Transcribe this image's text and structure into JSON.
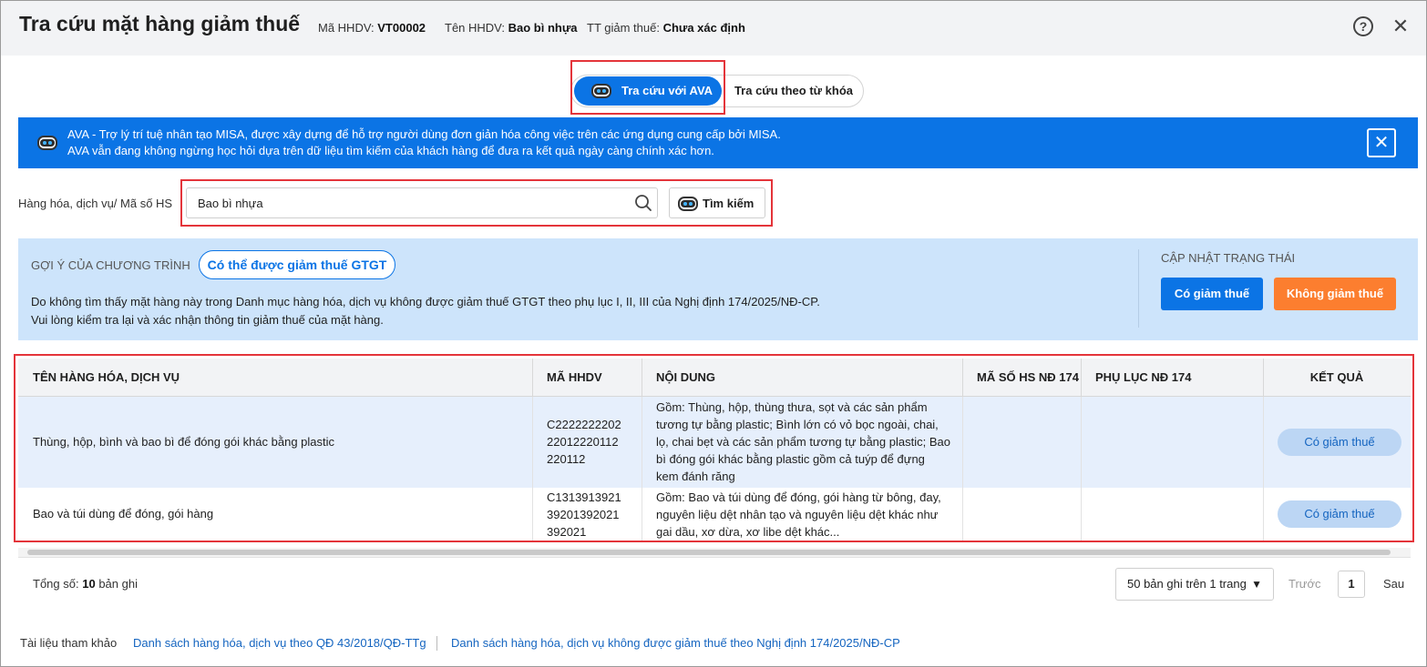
{
  "header": {
    "title": "Tra cứu mặt hàng giảm thuế",
    "meta": [
      {
        "label": "Mã HHDV:",
        "value": "VT00002"
      },
      {
        "label": "Tên HHDV:",
        "value": "Bao bì nhựa"
      },
      {
        "label": "TT giảm thuế:",
        "value": "Chưa xác định"
      }
    ],
    "help_icon": "help-circle-icon",
    "close_icon": "close-icon"
  },
  "mode_tabs": {
    "ava": "Tra cứu với AVA",
    "keyword": "Tra cứu theo từ khóa",
    "active": "ava"
  },
  "banner": {
    "line1": "AVA - Trợ lý trí tuệ nhân tạo MISA, được xây dựng để hỗ trợ người dùng đơn giản hóa công việc trên các ứng dụng cung cấp bởi MISA.",
    "line2": "AVA vẫn đang không ngừng học hỏi dựa trên dữ liệu tìm kiếm của khách hàng để đưa ra kết quả ngày càng chính xác hơn."
  },
  "search": {
    "label": "Hàng hóa, dịch vụ/ Mã số HS",
    "value": "Bao bì nhựa",
    "button": "Tìm kiếm"
  },
  "suggestion": {
    "title": "GỢI Ý CỦA CHƯƠNG TRÌNH",
    "chip": "Có thể được giảm thuế GTGT",
    "line1": "Do không tìm thấy mặt hàng này trong Danh mục hàng hóa, dịch vụ không được giảm thuế GTGT theo phụ lục I, II, III của Nghị định 174/2025/NĐ-CP.",
    "line2": "Vui lòng kiểm tra lại và xác nhận thông tin giảm thuế của mặt hàng.",
    "status_title": "CẬP NHẬT TRẠNG THÁI",
    "btn_yes": "Có giảm thuế",
    "btn_no": "Không giảm thuế"
  },
  "table": {
    "columns": [
      "TÊN HÀNG HÓA, DỊCH VỤ",
      "MÃ HHDV",
      "NỘI DUNG",
      "MÃ SỐ HS NĐ 174",
      "PHỤ LỤC NĐ 174",
      "KẾT QUẢ"
    ],
    "rows": [
      {
        "name": "Thùng, hộp, bình và bao bì để đóng gói khác bằng plastic",
        "code": [
          "C2222222202",
          "22012220112",
          "220112"
        ],
        "content": [
          "Gồm: Thùng, hộp, thùng thưa, sọt và các sản phẩm",
          "tương tự bằng plastic; Bình lớn có vỏ bọc ngoài, chai,",
          "lọ, chai bẹt và các sản phẩm tương tự bằng plastic; Bao",
          "bì đóng gói khác bằng plastic gồm cả tuýp để đựng",
          "kem đánh răng"
        ],
        "hs": "",
        "appendix": "",
        "result": "Có giảm thuế"
      },
      {
        "name": "Bao và túi dùng để đóng, gói hàng",
        "code": [
          "C1313913921",
          "39201392021",
          "392021"
        ],
        "content": [
          "Gồm: Bao và túi dùng để đóng, gói hàng từ bông, đay,",
          "nguyên liệu dệt nhân tạo và nguyên liệu dệt khác như",
          "gai dầu, xơ dừa, xơ libe dệt khác..."
        ],
        "hs": "",
        "appendix": "",
        "result": "Có giảm thuế"
      }
    ]
  },
  "pagination": {
    "total_label": "Tổng số:",
    "total_count": "10",
    "total_suffix": "bản ghi",
    "page_size": "50 bản ghi trên 1 trang",
    "prev": "Trước",
    "page": "1",
    "next": "Sau"
  },
  "references": {
    "label": "Tài liệu tham khảo",
    "link1": "Danh sách hàng hóa, dịch vụ theo QĐ 43/2018/QĐ-TTg",
    "link2": "Danh sách hàng hóa, dịch vụ không được giảm thuế theo Nghị định 174/2025/NĐ-CP"
  },
  "colors": {
    "primary": "#0b74e5",
    "orange": "#fc7e2f",
    "suggest_bg": "#cde4fb",
    "highlight": "#e4343a"
  }
}
